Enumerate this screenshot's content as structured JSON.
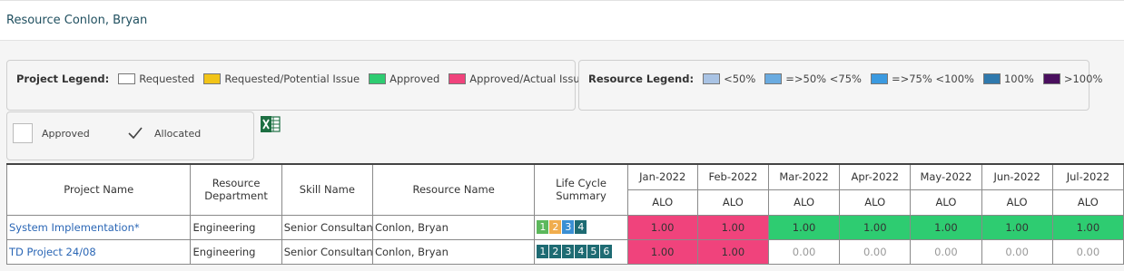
{
  "page": {
    "title": "Resource Conlon, Bryan"
  },
  "project_legend": {
    "title": "Project Legend:",
    "items": [
      {
        "label": "Requested",
        "color": "#ffffff"
      },
      {
        "label": "Requested/Potential Issue",
        "color": "#f2c418"
      },
      {
        "label": "Approved",
        "color": "#2ecc71"
      },
      {
        "label": "Approved/Actual Issue",
        "color": "#f0437c"
      }
    ]
  },
  "resource_legend": {
    "title": "Resource Legend:",
    "items": [
      {
        "label": "<50%",
        "color": "#a9c3e4"
      },
      {
        "label": "=>50% <75%",
        "color": "#6aabe0"
      },
      {
        "label": "=>75% <100%",
        "color": "#3b9ae0"
      },
      {
        "label": "100%",
        "color": "#2f79ad"
      },
      {
        "label": ">100%",
        "color": "#4a0f5e"
      }
    ]
  },
  "filters": {
    "approved_label": "Approved",
    "approved_checked": false,
    "allocated_label": "Allocated",
    "allocated_checked": true
  },
  "export": {
    "icon": "excel-export-icon",
    "color": "#1d6f42"
  },
  "grid": {
    "headers": {
      "project_name": "Project Name",
      "resource_department": "Resource Department",
      "skill_name": "Skill Name",
      "resource_name": "Resource Name",
      "life_cycle_summary": "Life Cycle Summary"
    },
    "months": [
      "Jan-2022",
      "Feb-2022",
      "Mar-2022",
      "Apr-2022",
      "May-2022",
      "Jun-2022",
      "Jul-2022"
    ],
    "sub_header": "ALO",
    "rows": [
      {
        "project_name": "System Implementation*",
        "resource_department": "Engineering",
        "skill_name": "Senior Consultant",
        "resource_name": "Conlon, Bryan",
        "life_cycle": [
          {
            "label": "1",
            "color": "#5cb85c"
          },
          {
            "label": "2",
            "color": "#f0ad4e"
          },
          {
            "label": "3",
            "color": "#3a8fd4"
          },
          {
            "label": "4",
            "color": "#1e6b73"
          }
        ],
        "values": [
          "1.00",
          "1.00",
          "1.00",
          "1.00",
          "1.00",
          "1.00",
          "1.00"
        ],
        "cell_colors": [
          "#f0437c",
          "#f0437c",
          "#2ecc71",
          "#2ecc71",
          "#2ecc71",
          "#2ecc71",
          "#2ecc71"
        ]
      },
      {
        "project_name": "TD Project 24/08",
        "resource_department": "Engineering",
        "skill_name": "Senior Consultant",
        "resource_name": "Conlon, Bryan",
        "life_cycle": [
          {
            "label": "1",
            "color": "#1e6b73"
          },
          {
            "label": "2",
            "color": "#1e6b73"
          },
          {
            "label": "3",
            "color": "#1e6b73"
          },
          {
            "label": "4",
            "color": "#1e6b73"
          },
          {
            "label": "5",
            "color": "#1e6b73"
          },
          {
            "label": "6",
            "color": "#1e6b73"
          }
        ],
        "values": [
          "1.00",
          "1.00",
          "0.00",
          "0.00",
          "0.00",
          "0.00",
          "0.00"
        ],
        "cell_colors": [
          "#f0437c",
          "#f0437c",
          "#ffffff",
          "#ffffff",
          "#ffffff",
          "#ffffff",
          "#ffffff"
        ]
      }
    ]
  }
}
